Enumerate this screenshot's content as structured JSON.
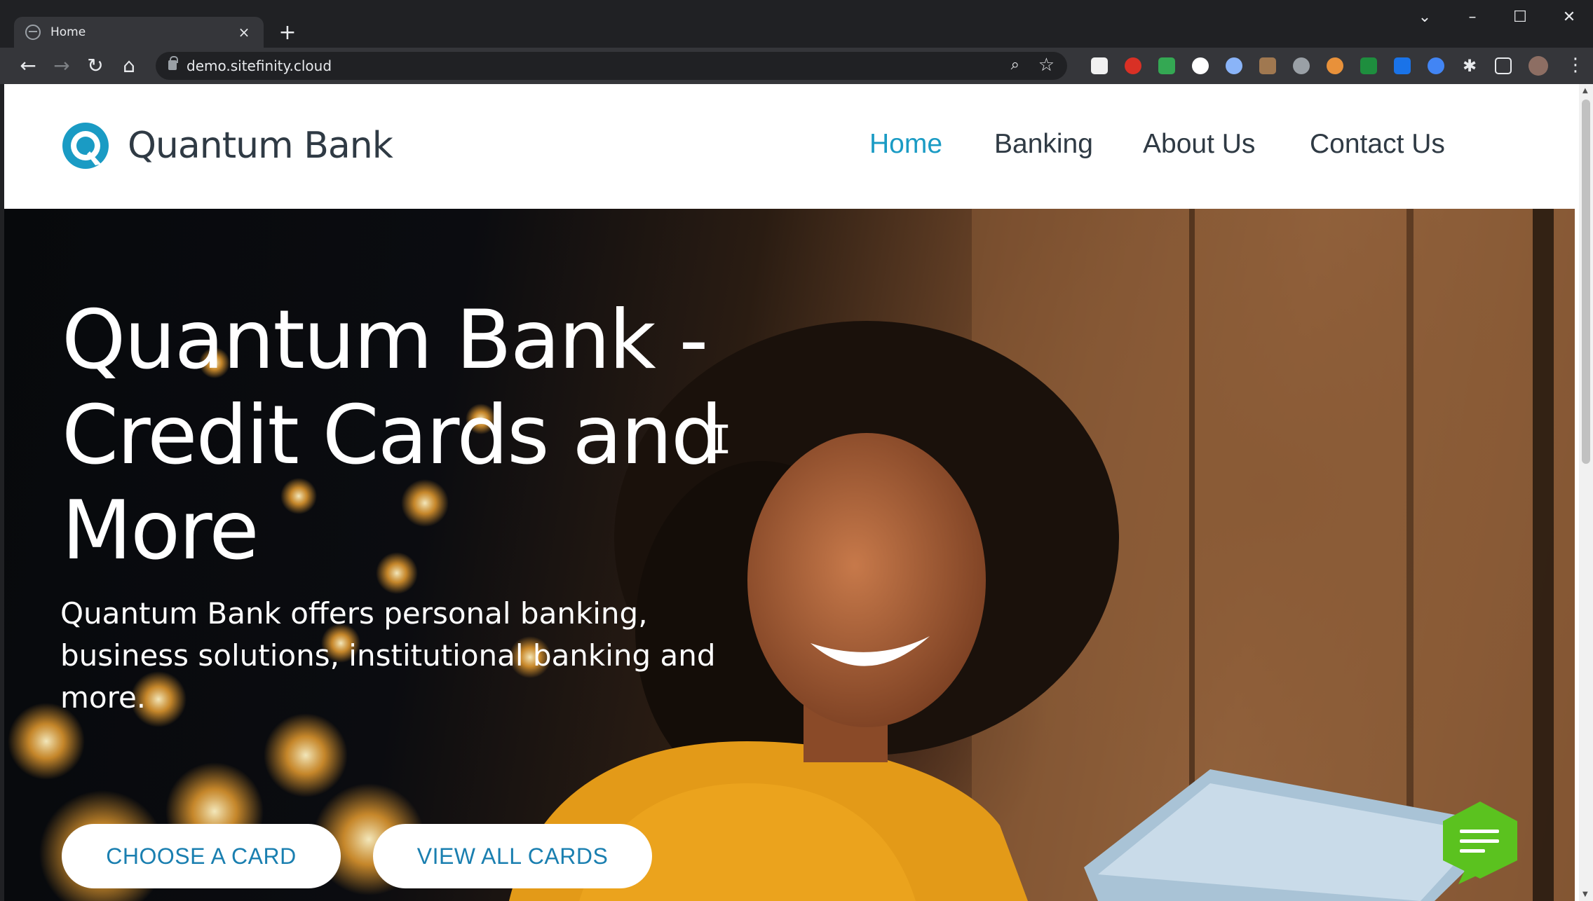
{
  "browser": {
    "tab_title": "Home",
    "tab_close": "×",
    "new_tab": "+",
    "url": "demo.sitefinity.cloud",
    "window_controls": {
      "tab_search": "⌄",
      "minimize": "–",
      "maximize": "☐",
      "close": "✕"
    },
    "nav": {
      "back": "←",
      "forward": "→",
      "reload": "↻",
      "home": "⌂"
    },
    "menu": "⋮"
  },
  "site": {
    "logo_text": "Quantum Bank",
    "nav": [
      "Home",
      "Banking",
      "About Us",
      "Contact Us"
    ],
    "active_nav": "Home"
  },
  "hero": {
    "title": "Quantum Bank - Credit Cards and More",
    "subtitle": "Quantum Bank offers personal banking, business solutions, institutional banking and more.",
    "buttons": [
      "CHOOSE A CARD",
      "VIEW ALL CARDS"
    ]
  },
  "colors": {
    "brand_teal": "#1a9bc4",
    "nav_text": "#2f3a44",
    "cta_text": "#1a7fb0",
    "chat_green": "#5bc21f"
  },
  "icons": [
    "back-icon",
    "forward-icon",
    "reload-icon",
    "home-icon",
    "lock-icon",
    "zoom-icon",
    "star-icon",
    "extensions-icon",
    "chat-icon"
  ]
}
